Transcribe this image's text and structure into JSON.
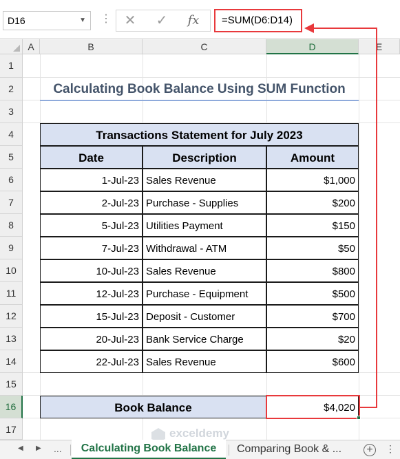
{
  "formula_bar": {
    "name_box": "D16",
    "cancel_glyph": "✕",
    "enter_glyph": "✓",
    "fx_glyph": "fx",
    "formula": "=SUM(D6:D14)"
  },
  "columns": [
    "A",
    "B",
    "C",
    "D",
    "E"
  ],
  "selected_column": "D",
  "rows": [
    "1",
    "2",
    "3",
    "4",
    "5",
    "6",
    "7",
    "8",
    "9",
    "10",
    "11",
    "12",
    "13",
    "14",
    "15",
    "16",
    "17"
  ],
  "selected_row": "16",
  "title": "Calculating Book Balance Using SUM Function",
  "table": {
    "caption": "Transactions Statement for July 2023",
    "headers": [
      "Date",
      "Description",
      "Amount"
    ],
    "rows": [
      {
        "date": "1-Jul-23",
        "description": "Sales Revenue",
        "amount": "$1,000"
      },
      {
        "date": "2-Jul-23",
        "description": "Purchase - Supplies",
        "amount": "$200"
      },
      {
        "date": "5-Jul-23",
        "description": "Utilities Payment",
        "amount": "$150"
      },
      {
        "date": "7-Jul-23",
        "description": "Withdrawal - ATM",
        "amount": "$50"
      },
      {
        "date": "10-Jul-23",
        "description": "Sales Revenue",
        "amount": "$800"
      },
      {
        "date": "12-Jul-23",
        "description": "Purchase - Equipment",
        "amount": "$500"
      },
      {
        "date": "15-Jul-23",
        "description": "Deposit - Customer",
        "amount": "$700"
      },
      {
        "date": "20-Jul-23",
        "description": "Bank Service Charge",
        "amount": "$20"
      },
      {
        "date": "22-Jul-23",
        "description": "Sales Revenue",
        "amount": "$600"
      }
    ]
  },
  "balance": {
    "label": "Book Balance",
    "value": "$4,020"
  },
  "tabs": {
    "ellipsis": "...",
    "active": "Calculating Book Balance",
    "other": "Comparing Book & ...",
    "add": "+",
    "more": "⋮"
  },
  "watermark": "exceldemy",
  "colors": {
    "accent": "#217346",
    "highlight": "#e8393c",
    "header_fill": "#d9e1f2",
    "title": "#44546a"
  }
}
